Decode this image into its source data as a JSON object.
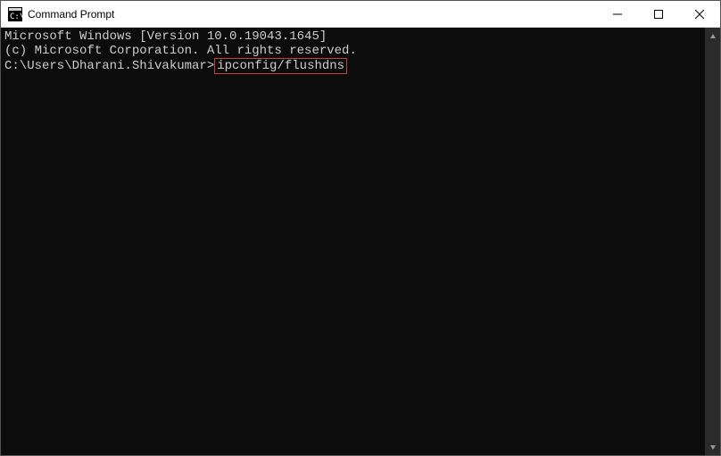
{
  "window": {
    "title": "Command Prompt",
    "icon_name": "cmd-icon"
  },
  "terminal": {
    "line1": "Microsoft Windows [Version 10.0.19043.1645]",
    "line2": "(c) Microsoft Corporation. All rights reserved.",
    "blank1": "",
    "prompt": "C:\\Users\\Dharani.Shivakumar>",
    "command": "ipconfig/flushdns"
  },
  "highlight": {
    "color": "#c04040"
  }
}
